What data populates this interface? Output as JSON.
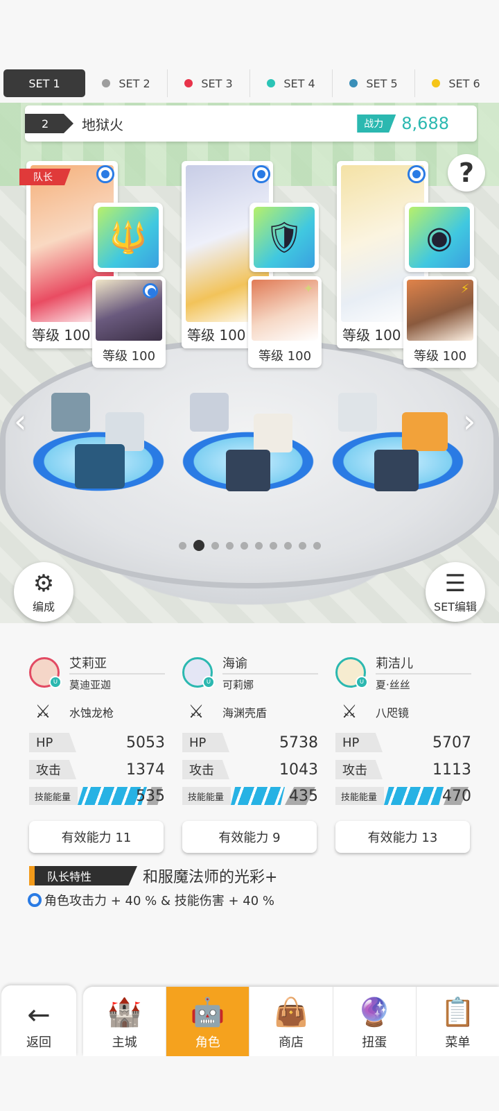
{
  "tabs": [
    {
      "label": "SET 1",
      "active": true,
      "color": ""
    },
    {
      "label": "SET 2",
      "active": false,
      "color": "#9e9e9e"
    },
    {
      "label": "SET 3",
      "active": false,
      "color": "#e8334a"
    },
    {
      "label": "SET 4",
      "active": false,
      "color": "#2bc4b6"
    },
    {
      "label": "SET 5",
      "active": false,
      "color": "#3a8fb8"
    },
    {
      "label": "SET 6",
      "active": false,
      "color": "#f5c518"
    }
  ],
  "team": {
    "number": "2",
    "name": "地狱火",
    "power_label": "战力",
    "power": "8,688"
  },
  "help_label": "?",
  "captain_tag": "队长",
  "cards": [
    {
      "level": "等级 100",
      "sub_level": "等级 100"
    },
    {
      "level": "等级 100",
      "sub_level": "等级 100"
    },
    {
      "level": "等级 100",
      "sub_level": "等级 100"
    }
  ],
  "formation_button": "编成",
  "set_edit_button": "SET编辑",
  "characters": [
    {
      "name": "艾莉亚",
      "sub_name": "莫迪亚迦",
      "weapon": "水蚀龙枪",
      "hp_label": "HP",
      "hp": "5053",
      "atk_label": "攻击",
      "atk": "1374",
      "energy_label": "技能能量",
      "energy": "535",
      "ability": "有效能力 11"
    },
    {
      "name": "海谕",
      "sub_name": "可莉娜",
      "weapon": "海渊壳盾",
      "hp_label": "HP",
      "hp": "5738",
      "atk_label": "攻击",
      "atk": "1043",
      "energy_label": "技能能量",
      "energy": "435",
      "ability": "有效能力 9"
    },
    {
      "name": "莉洁儿",
      "sub_name": "夏·丝丝",
      "weapon": "八咫镜",
      "hp_label": "HP",
      "hp": "5707",
      "atk_label": "攻击",
      "atk": "1113",
      "energy_label": "技能能量",
      "energy": "470",
      "ability": "有效能力 13"
    }
  ],
  "leader": {
    "tag": "队长特性",
    "title": "和服魔法师的光彩+",
    "desc": "角色攻击力 + 40 % & 技能伤害 + 40 %"
  },
  "nav": {
    "back": "返回",
    "items": [
      {
        "label": "主城",
        "active": false
      },
      {
        "label": "角色",
        "active": true
      },
      {
        "label": "商店",
        "active": false
      },
      {
        "label": "扭蛋",
        "active": false
      },
      {
        "label": "菜单",
        "active": false
      }
    ]
  },
  "page_dots": {
    "count": 10,
    "active_index": 1
  },
  "colors": {
    "accent_teal": "#2bb8b0",
    "nav_active": "#f5a21e",
    "energy_blue": "#27b2e4",
    "leader_orange": "#f29a1a"
  }
}
